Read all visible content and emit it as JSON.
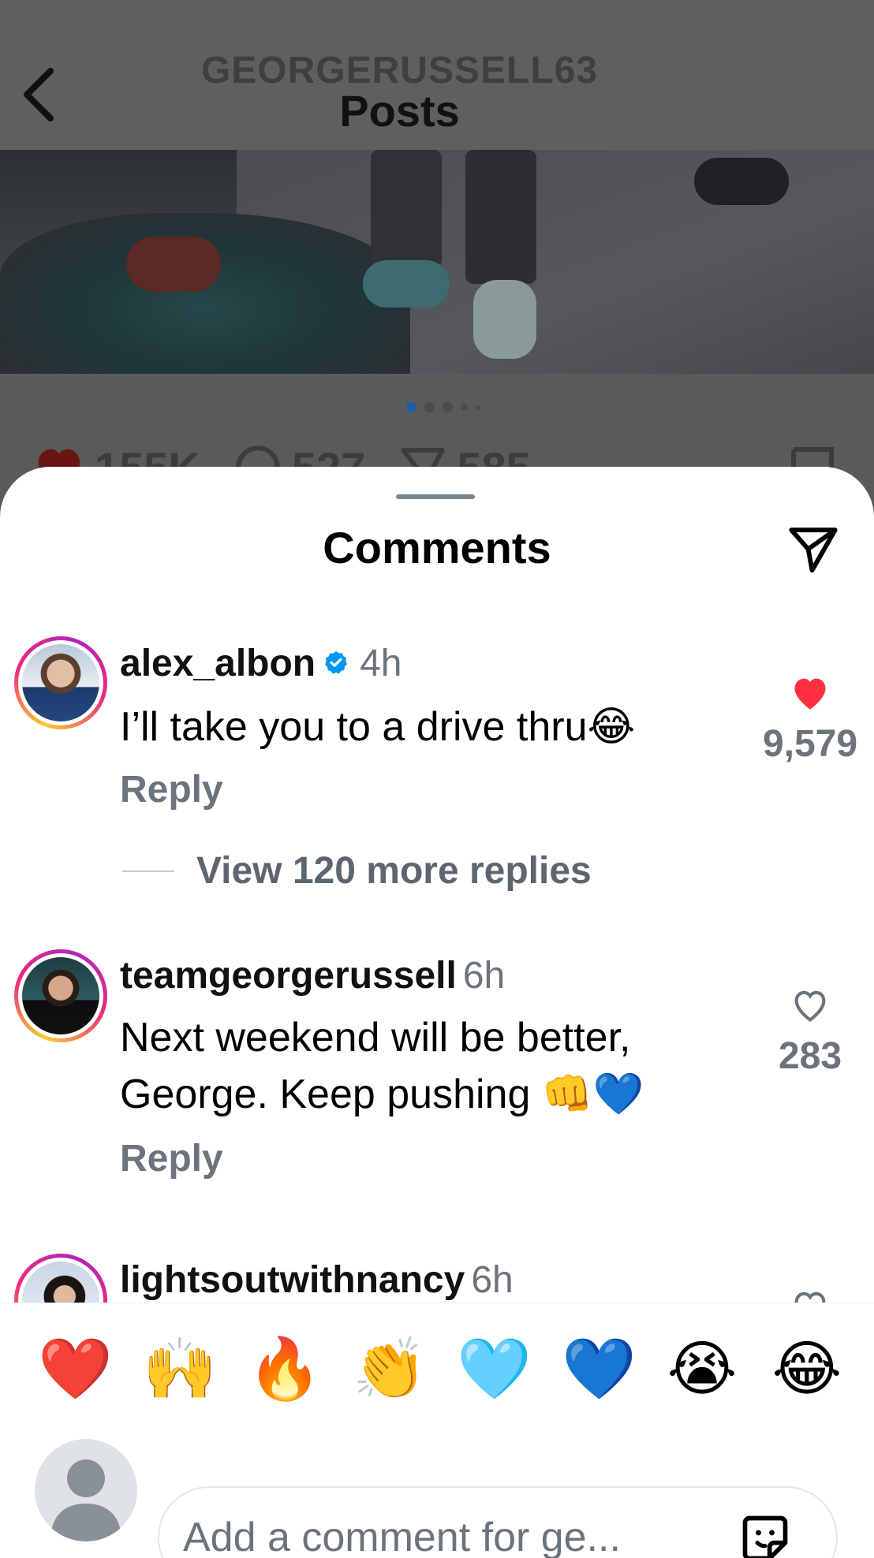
{
  "header": {
    "username": "GEORGERUSSELL63",
    "title": "Posts"
  },
  "post": {
    "likes": "155K",
    "comments": "527",
    "shares": "585"
  },
  "sheet": {
    "title": "Comments"
  },
  "comments": [
    {
      "user": "alex_albon",
      "verified": true,
      "time": "4h",
      "text": "I’ll take you to a drive thru😂",
      "reply_label": "Reply",
      "likes": "9,579",
      "liked": true
    },
    {
      "more_replies": "View 120 more replies"
    },
    {
      "user": "teamgeorgerussell",
      "verified": false,
      "time": "6h",
      "text": "Next weekend will be better, George. Keep pushing 👊💙",
      "reply_label": "Reply",
      "likes": "283",
      "liked": false
    },
    {
      "user": "lightsoutwithnancy",
      "verified": false,
      "time": "6h"
    }
  ],
  "quick_reactions": [
    "❤️",
    "🙌",
    "🔥",
    "👏",
    "🩵",
    "💙",
    "😭",
    "😂"
  ],
  "composer": {
    "placeholder": "Add a comment for ge..."
  },
  "colors": {
    "liked_heart": "#ff3040",
    "verified_blue": "#0095f6",
    "muted_text": "#6b737c"
  },
  "icons": {
    "back": "chevron-left-icon",
    "share": "paper-plane-icon",
    "verified": "verified-badge-icon",
    "like": "heart-icon",
    "sticker": "sticker-icon",
    "profile": "default-avatar-icon"
  }
}
